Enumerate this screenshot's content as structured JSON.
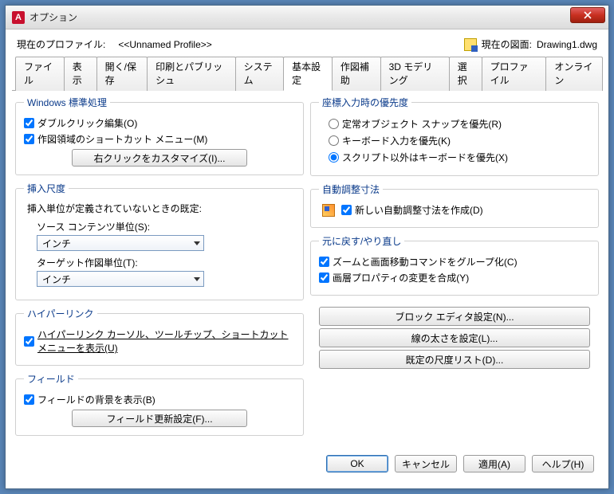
{
  "title": "オプション",
  "profile": {
    "label": "現在のプロファイル:",
    "value": "<<Unnamed Profile>>",
    "drawing_label": "現在の図面:",
    "drawing_value": "Drawing1.dwg"
  },
  "tabs": [
    "ファイル",
    "表示",
    "開く/保存",
    "印刷とパブリッシュ",
    "システム",
    "基本設定",
    "作図補助",
    "3D モデリング",
    "選択",
    "プロファイル",
    "オンライン"
  ],
  "active_tab_index": 5,
  "left": {
    "group1": {
      "legend": "Windows 標準処理",
      "chk1": "ダブルクリック編集(O)",
      "chk2": "作図領域のショートカット メニュー(M)",
      "btn": "右クリックをカスタマイズ(I)..."
    },
    "group2": {
      "legend": "挿入尺度",
      "desc": "挿入単位が定義されていないときの既定:",
      "src_label": "ソース コンテンツ単位(S):",
      "src_value": "インチ",
      "tgt_label": "ターゲット作図単位(T):",
      "tgt_value": "インチ"
    },
    "group3": {
      "legend": "ハイパーリンク",
      "chk": "ハイパーリンク カーソル、ツールチップ、ショートカットメニューを表示(U)"
    },
    "group4": {
      "legend": "フィールド",
      "chk": "フィールドの背景を表示(B)",
      "btn": "フィールド更新設定(F)..."
    }
  },
  "right": {
    "group1": {
      "legend": "座標入力時の優先度",
      "r1": "定常オブジェクト スナップを優先(R)",
      "r2": "キーボード入力を優先(K)",
      "r3": "スクリプト以外はキーボードを優先(X)"
    },
    "group2": {
      "legend": "自動調整寸法",
      "chk": "新しい自動調整寸法を作成(D)"
    },
    "group3": {
      "legend": "元に戻す/やり直し",
      "chk1": "ズームと画面移動コマンドをグループ化(C)",
      "chk2": "画層プロパティの変更を合成(Y)"
    },
    "btn1": "ブロック エディタ設定(N)...",
    "btn2": "線の太さを設定(L)...",
    "btn3": "既定の尺度リスト(D)..."
  },
  "buttons": {
    "ok": "OK",
    "cancel": "キャンセル",
    "apply": "適用(A)",
    "help": "ヘルプ(H)"
  }
}
